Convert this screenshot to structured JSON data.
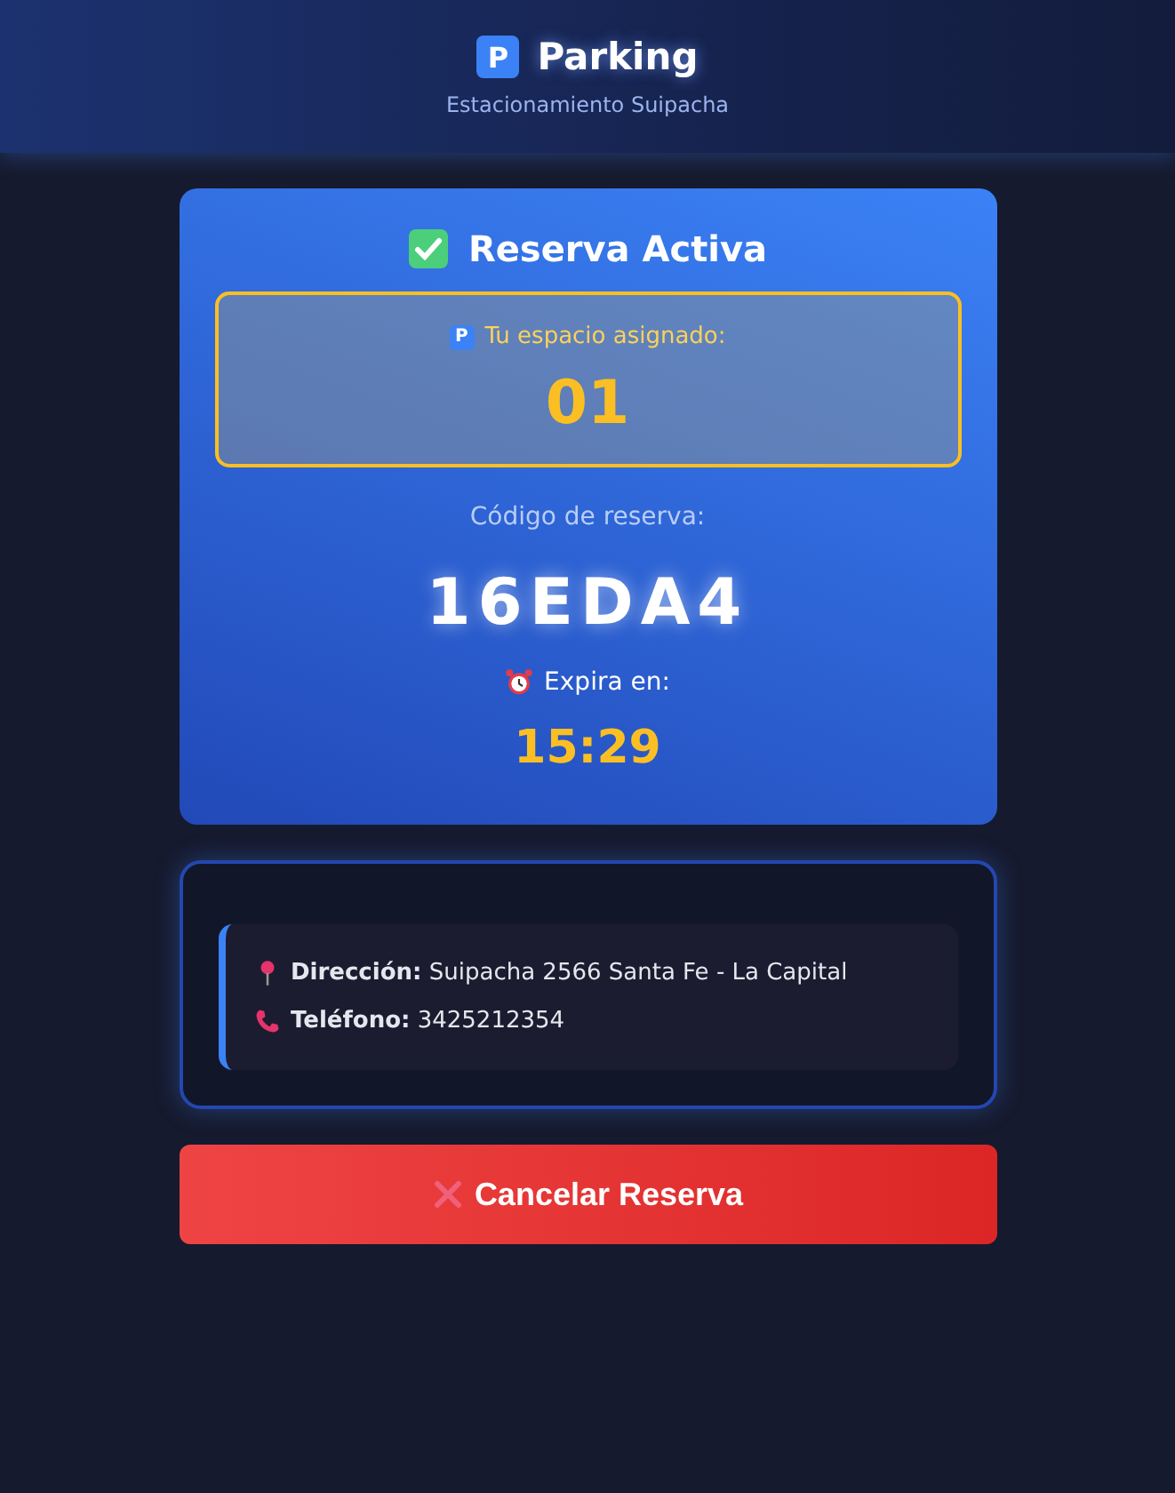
{
  "header": {
    "icon": "P",
    "title": "Parking",
    "subtitle": "Estacionamiento Suipacha"
  },
  "reservation": {
    "title": "Reserva Activa",
    "spot_icon": "P",
    "spot_label": "Tu espacio asignado:",
    "spot": "01",
    "code_label": "Código de reserva:",
    "code": "16EDA4",
    "expires_label": "Expira en:",
    "expires": "15:29"
  },
  "info": [
    {
      "kind": "address",
      "label": "Dirección:",
      "value": "Suipacha 2566 Santa Fe - La Capital"
    },
    {
      "kind": "phone",
      "label": "Teléfono:",
      "value": "3425212354"
    }
  ],
  "cancel_button": "Cancelar Reserva"
}
